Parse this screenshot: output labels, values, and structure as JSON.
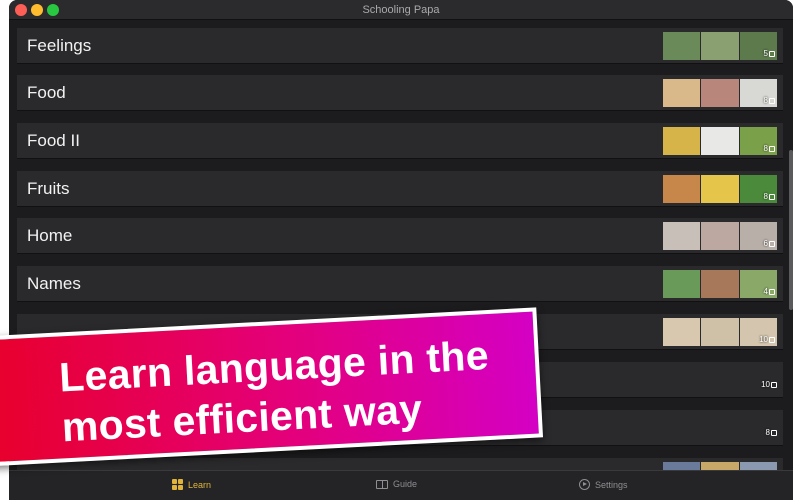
{
  "window": {
    "title": "Schooling Papa"
  },
  "categories": [
    {
      "label": "Feelings",
      "count": "5",
      "thumbs": [
        "#6a8a5a",
        "#8aa070",
        "#5c7a4c"
      ]
    },
    {
      "label": "Food",
      "count": "8",
      "thumbs": [
        "#d9b98a",
        "#b8867a",
        "#d8d8d4"
      ]
    },
    {
      "label": "Food II",
      "count": "8",
      "thumbs": [
        "#d6b44a",
        "#e8e8e6",
        "#7aa04a"
      ]
    },
    {
      "label": "Fruits",
      "count": "8",
      "thumbs": [
        "#c8874a",
        "#e6c64a",
        "#4a8a3a"
      ]
    },
    {
      "label": "Home",
      "count": "6",
      "thumbs": [
        "#c8c0b8",
        "#bca8a0",
        "#b8b0a8"
      ]
    },
    {
      "label": "Names",
      "count": "4",
      "thumbs": [
        "#6a9a5a",
        "#a8785a",
        "#8aa868"
      ]
    },
    {
      "label": "",
      "count": "10",
      "thumbs": [
        "#d8c8b0",
        "#cfc0a8",
        "#d4c6ae"
      ]
    },
    {
      "label": "",
      "count": "10",
      "thumbs": []
    },
    {
      "label": "",
      "count": "8",
      "thumbs": []
    },
    {
      "label": "",
      "count": "",
      "thumbs": [
        "#6a7a9a",
        "#c8a868",
        "#8a98b0"
      ]
    }
  ],
  "banner": {
    "text": "Learn language in the most efficient way"
  },
  "tabs": {
    "learn": "Learn",
    "guide": "Guide",
    "settings": "Settings"
  },
  "colors": {
    "accent": "#e0b43a",
    "banner_start": "#e8002a",
    "banner_end": "#d400c4"
  },
  "icons": {
    "learn": "grid-icon",
    "guide": "book-icon",
    "settings": "play-circle-icon",
    "count": "card-icon"
  }
}
